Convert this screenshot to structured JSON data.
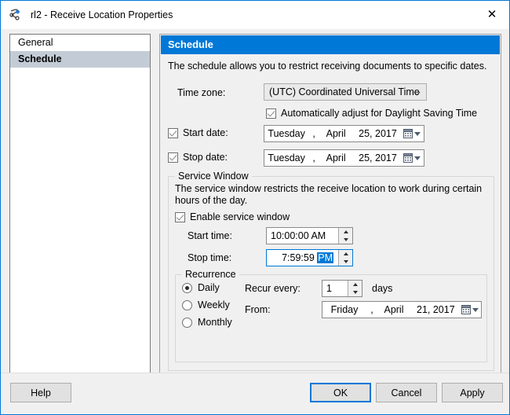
{
  "window": {
    "title": "rl2 - Receive Location Properties",
    "icon": "receive-location-icon",
    "close_label": "✕"
  },
  "sidebar": {
    "items": [
      {
        "label": "General",
        "selected": false
      },
      {
        "label": "Schedule",
        "selected": true
      }
    ]
  },
  "panel": {
    "header": "Schedule",
    "description": "The schedule allows you to restrict receiving documents to specific dates.",
    "timezone": {
      "label": "Time zone:",
      "value": "(UTC) Coordinated Universal Time"
    },
    "dst": {
      "label": "Automatically adjust for Daylight Saving Time",
      "checked": true
    },
    "start_date": {
      "label": "Start date:",
      "checked": true,
      "day": "Tuesday",
      "separator": ",",
      "month": "April",
      "date": "25, 2017"
    },
    "stop_date": {
      "label": "Stop date:",
      "checked": true,
      "day": "Tuesday",
      "separator": ",",
      "month": "April",
      "date": "25, 2017"
    },
    "service_window": {
      "title": "Service Window",
      "description": "The service window restricts the receive location to work during certain hours of the day.",
      "enable": {
        "label": "Enable service window",
        "checked": true
      },
      "start_time": {
        "label": "Start time:",
        "value": "10:00:00 AM"
      },
      "stop_time": {
        "label": "Stop time:",
        "value_prefix": "7:59:59 ",
        "value_selected": "PM",
        "focused": true
      },
      "recurrence": {
        "title": "Recurrence",
        "options": [
          {
            "label": "Daily",
            "selected": true
          },
          {
            "label": "Weekly",
            "selected": false
          },
          {
            "label": "Monthly",
            "selected": false
          }
        ],
        "recur_every": {
          "label": "Recur every:",
          "value": "1",
          "unit": "days"
        },
        "from": {
          "label": "From:",
          "day": "Friday",
          "separator": ",",
          "month": "April",
          "date": "21, 2017"
        }
      }
    }
  },
  "footer": {
    "help": "Help",
    "ok": "OK",
    "cancel": "Cancel",
    "apply": "Apply"
  },
  "colors": {
    "accent": "#0078d7",
    "panel_bg": "#f0f0f0",
    "selection_bg": "#c3ccd6"
  }
}
